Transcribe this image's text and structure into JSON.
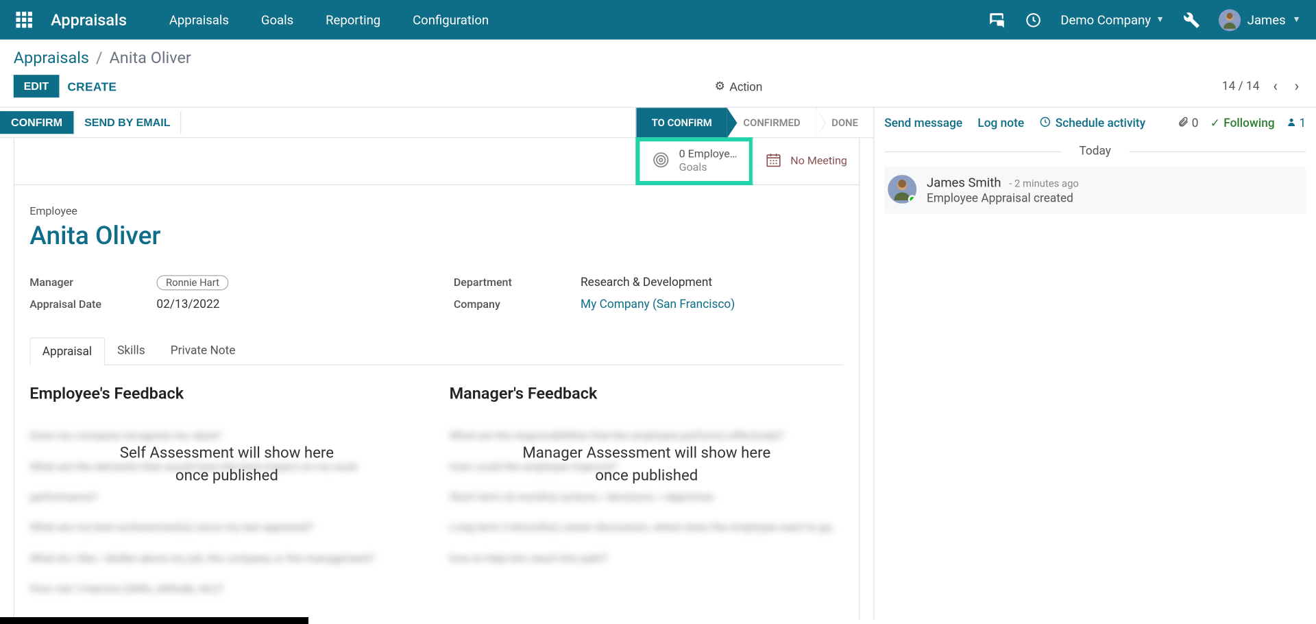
{
  "topbar": {
    "brand": "Appraisals",
    "menu": [
      "Appraisals",
      "Goals",
      "Reporting",
      "Configuration"
    ],
    "company": "Demo Company",
    "user": "James"
  },
  "breadcrumb": {
    "root": "Appraisals",
    "leaf": "Anita Oliver"
  },
  "buttons": {
    "edit": "EDIT",
    "create": "CREATE",
    "action": "Action"
  },
  "pager": {
    "current": "14",
    "total": "14"
  },
  "statusbar": {
    "confirm": "CONFIRM",
    "send_email": "SEND BY EMAIL",
    "stages": [
      "TO CONFIRM",
      "CONFIRMED",
      "DONE"
    ],
    "active_index": 0
  },
  "stat_buttons": {
    "goals_line1": "0 Employe…",
    "goals_line2": "Goals",
    "meeting": "No Meeting"
  },
  "form": {
    "employee_label": "Employee",
    "employee_name": "Anita Oliver",
    "fields": {
      "manager_label": "Manager",
      "manager_value": "Ronnie Hart",
      "date_label": "Appraisal Date",
      "date_value": "02/13/2022",
      "dept_label": "Department",
      "dept_value": "Research & Development",
      "company_label": "Company",
      "company_value": "My Company (San Francisco)"
    },
    "tabs": [
      "Appraisal",
      "Skills",
      "Private Note"
    ]
  },
  "feedback": {
    "employee_title": "Employee's Feedback",
    "manager_title": "Manager's Feedback",
    "employee_overlay_l1": "Self Assessment will show here",
    "employee_overlay_l2": "once published",
    "manager_overlay_l1": "Manager Assessment will show here",
    "manager_overlay_l2": "once published",
    "emp_blur": [
      "Does my company recognize my value?",
      "What are the elements that would have the best impact on my work performance?",
      "What are my best achievement(s) since my last appraisal?",
      "What do I like / dislike about my job, the company or the management?",
      "How can I improve (skills, attitude, etc)?"
    ],
    "mgr_blur": [
      "What are the responsibilities that the employee performs effectively?",
      "How could the employee improve?",
      "Short term (6-months) actions / decisions / objectives",
      "Long term (>6months) career discussion, where does the employee want to go, how to help him reach this path?"
    ]
  },
  "chatter": {
    "send": "Send message",
    "log": "Log note",
    "schedule": "Schedule activity",
    "attach_count": "0",
    "following": "Following",
    "followers": "1",
    "today": "Today",
    "msg_author": "James Smith",
    "msg_time": "- 2 minutes ago",
    "msg_body": "Employee Appraisal created"
  }
}
